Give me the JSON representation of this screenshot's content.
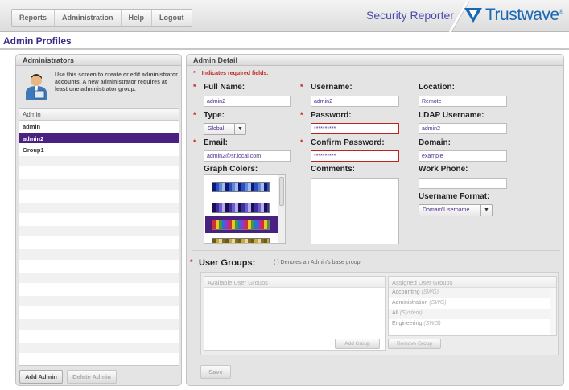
{
  "nav": {
    "items": [
      "Reports",
      "Administration",
      "Help",
      "Logout"
    ]
  },
  "brand": {
    "app_name": "Security Reporter",
    "logo_text": "Trustwave",
    "accent": "#1a68b2"
  },
  "page": {
    "title": "Admin Profiles"
  },
  "administrators": {
    "header": "Administrators",
    "intro": "Use this screen to create or edit administrator accounts. A new administrator requires at least one administrator group.",
    "list_header": "Admin",
    "items": [
      "admin",
      "admin2",
      "Group1"
    ],
    "selected": "admin2",
    "add_label": "Add Admin",
    "delete_label": "Delete Admin"
  },
  "detail": {
    "header": "Admin Detail",
    "required_note": "Indicates required fields.",
    "full_name": {
      "label": "Full Name:",
      "value": "admin2"
    },
    "username": {
      "label": "Username:",
      "value": "admin2"
    },
    "location": {
      "label": "Location:",
      "value": "Remote"
    },
    "type": {
      "label": "Type:",
      "value": "Global"
    },
    "password": {
      "label": "Password:",
      "value": "**********"
    },
    "ldap_username": {
      "label": "LDAP Username:",
      "value": "admin2"
    },
    "email": {
      "label": "Email:",
      "value": "admin2@sr.local.com"
    },
    "confirm_password": {
      "label": "Confirm Password:",
      "value": "**********"
    },
    "domain": {
      "label": "Domain:",
      "value": "example"
    },
    "graph_colors": {
      "label": "Graph Colors:"
    },
    "comments": {
      "label": "Comments:"
    },
    "work_phone": {
      "label": "Work Phone:",
      "value": ""
    },
    "username_format": {
      "label": "Username Format:",
      "value": "Domain\\Username"
    },
    "user_groups": {
      "label": "User Groups:",
      "note": "( ) Denotes an Admin's base group.",
      "available_header": "Available User Groups",
      "assigned_header": "Assigned User Groups",
      "assigned": [
        {
          "name": "Accounting",
          "tag": "(SWG)"
        },
        {
          "name": "Administration",
          "tag": "(SWG)"
        },
        {
          "name": "All",
          "tag": "(System)"
        },
        {
          "name": "Engineering",
          "tag": "(SWG)"
        }
      ],
      "add_group_label": "Add Group",
      "remove_group_label": "Remove Group"
    },
    "save_label": "Save"
  }
}
